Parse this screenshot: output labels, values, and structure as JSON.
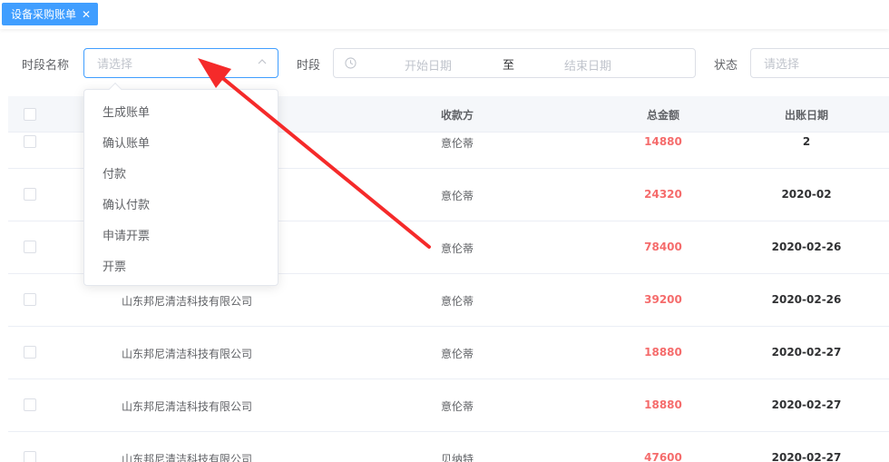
{
  "tabs": [
    {
      "label": "设备采购账单"
    }
  ],
  "filters": {
    "period_name_label": "时段名称",
    "period_name_placeholder": "请选择",
    "period_label": "时段",
    "start_date_placeholder": "开始日期",
    "range_separator": "至",
    "end_date_placeholder": "结束日期",
    "status_label": "状态",
    "status_placeholder": "请选择"
  },
  "dropdown": {
    "options": [
      "生成账单",
      "确认账单",
      "付款",
      "确认付款",
      "申请开票",
      "开票"
    ]
  },
  "table": {
    "columns": [
      "收款方",
      "总金额",
      "出账日期"
    ],
    "rows": [
      {
        "company": "",
        "payee": "意伦蒂",
        "amount": "14880",
        "date": "2"
      },
      {
        "company": "",
        "payee": "意伦蒂",
        "amount": "24320",
        "date": "2020-02"
      },
      {
        "company": "",
        "payee": "意伦蒂",
        "amount": "78400",
        "date": "2020-02-26"
      },
      {
        "company": "山东邦尼清洁科技有限公司",
        "payee": "意伦蒂",
        "amount": "39200",
        "date": "2020-02-26"
      },
      {
        "company": "山东邦尼清洁科技有限公司",
        "payee": "意伦蒂",
        "amount": "18880",
        "date": "2020-02-27"
      },
      {
        "company": "山东邦尼清洁科技有限公司",
        "payee": "意伦蒂",
        "amount": "18880",
        "date": "2020-02-27"
      },
      {
        "company": "山东邦尼清洁科技有限公司",
        "payee": "贝纳特",
        "amount": "47600",
        "date": "2020-02-27"
      }
    ]
  },
  "colors": {
    "primary": "#409eff",
    "amount": "#f56c6c",
    "annotation": "#f52a2a"
  }
}
